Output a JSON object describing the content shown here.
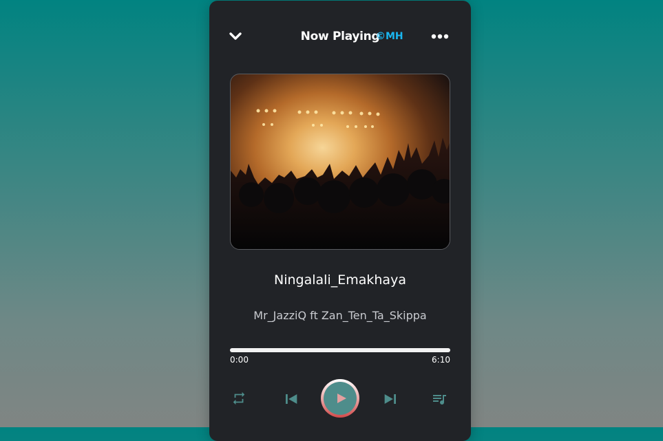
{
  "header": {
    "title": "Now Playing",
    "copyright": "©MH",
    "icons": {
      "collapse": "chevron-down-icon",
      "menu": "more-horizontal-icon"
    }
  },
  "track": {
    "title": "Ningalali_Emakhaya",
    "artist": "Mr_JazziQ ft Zan_Ten_Ta_Skippa",
    "current_time": "0:00",
    "duration": "6:10",
    "progress_fraction": 1.0
  },
  "controls": {
    "icons": [
      "repeat-icon",
      "skip-previous-icon",
      "play-icon",
      "skip-next-icon",
      "queue-music-icon"
    ]
  },
  "colors": {
    "accent": "#1ab6f0",
    "icon": "#4e8d8b",
    "card": "#212327"
  }
}
